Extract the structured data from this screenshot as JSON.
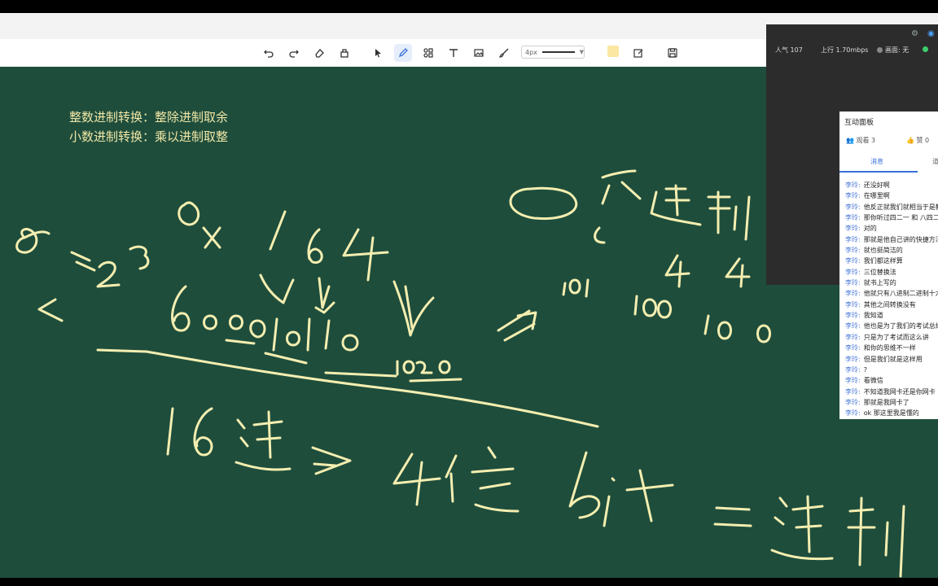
{
  "toolbar": {
    "tools": [
      {
        "name": "undo-icon",
        "glyph": "undo"
      },
      {
        "name": "redo-icon",
        "glyph": "redo"
      },
      {
        "name": "eraser-icon",
        "glyph": "eraser"
      },
      {
        "name": "clear-icon",
        "glyph": "clear"
      },
      {
        "name": "select-pointer-icon",
        "glyph": "pointer"
      },
      {
        "name": "pen-icon",
        "glyph": "pen"
      },
      {
        "name": "shapes-icon",
        "glyph": "shapes"
      },
      {
        "name": "text-tool-icon",
        "glyph": "T"
      },
      {
        "name": "image-icon",
        "glyph": "image"
      },
      {
        "name": "brush-icon",
        "glyph": "brush"
      }
    ],
    "pen_size": "4px",
    "pen_color": "#fbe7a1",
    "active_tool": "pen-icon"
  },
  "board": {
    "background": "#1e4d3c",
    "ink_color": "#f4eeb0",
    "rule_line_1": "整数进制转换：整除进制取余",
    "rule_line_2": "小数进制转换：乘以进制取整"
  },
  "stats": {
    "popularity": "人气 107",
    "upload": "上行 1.70mbps",
    "video": "画面: 无"
  },
  "panel": {
    "title": "互动面板",
    "viewers": "观看 3",
    "likes": "赞 0",
    "tab_messages": "消息",
    "tab_other": "道",
    "messages": [
      {
        "who": "李玲:",
        "text": "还没好啊"
      },
      {
        "who": "李玲:",
        "text": "在哪里啊"
      },
      {
        "who": "李玲:",
        "text": "他反正就我们就相当于是教"
      },
      {
        "who": "李玲:",
        "text": "那你听过四二一 和 八四二"
      },
      {
        "who": "李玲:",
        "text": "对的"
      },
      {
        "who": "李玲:",
        "text": "那就是他自己讲的快捷方法"
      },
      {
        "who": "李玲:",
        "text": "就也挺简洁的"
      },
      {
        "who": "李玲:",
        "text": "我们都这样算"
      },
      {
        "who": "李玲:",
        "text": "三位替换法"
      },
      {
        "who": "李玲:",
        "text": "就书上写的"
      },
      {
        "who": "李玲:",
        "text": "他就只有八进制二进制十六"
      },
      {
        "who": "李玲:",
        "text": "其他之间转换没有"
      },
      {
        "who": "李玲:",
        "text": "我知道"
      },
      {
        "who": "李玲:",
        "text": "他也是为了我们的考试总结"
      },
      {
        "who": "李玲:",
        "text": "只是为了考试而这么讲"
      },
      {
        "who": "李玲:",
        "text": "和你的思维不一样"
      },
      {
        "who": "李玲:",
        "text": "但是我们就是这样用"
      },
      {
        "who": "李玲:",
        "text": "?"
      },
      {
        "who": "李玲:",
        "text": "看微信"
      },
      {
        "who": "李玲:",
        "text": "不知道我网卡还是你网卡"
      },
      {
        "who": "李玲:",
        "text": "那就是我网卡了"
      },
      {
        "who": "李玲:",
        "text": "ok 那这里我是懂的"
      }
    ]
  }
}
